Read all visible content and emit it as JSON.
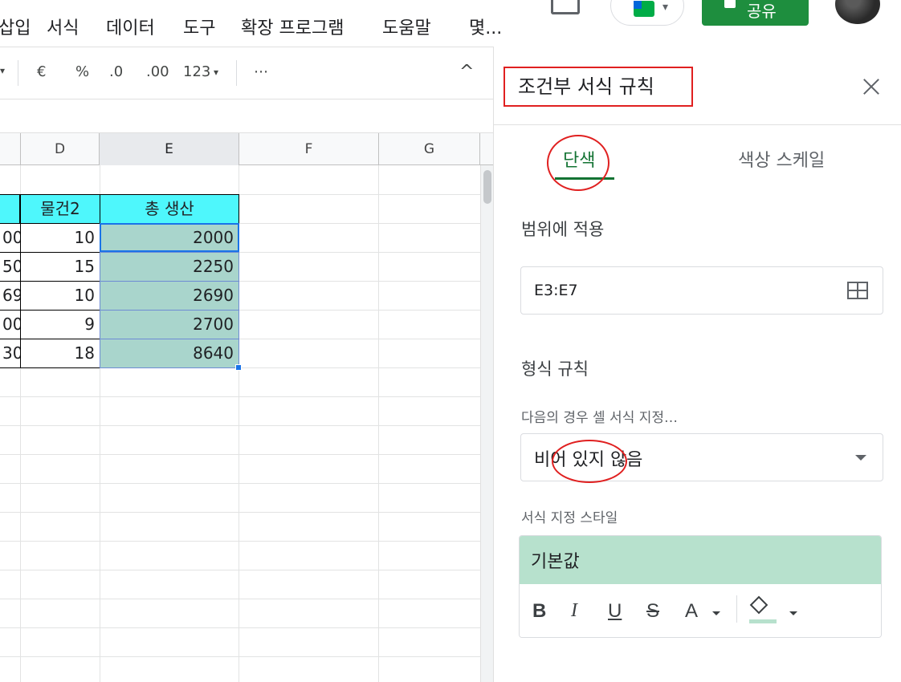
{
  "menu": [
    "삽입",
    "서식",
    "데이터",
    "도구",
    "확장 프로그램",
    "도움말",
    "몇..."
  ],
  "header": {
    "share_label": "공유"
  },
  "toolbar": {
    "currency": "€",
    "percent": "%",
    "dec_decrease": ".0",
    "dec_increase": ".00",
    "number_format": "123",
    "more": "⋯",
    "collapse": "^"
  },
  "columns": [
    "",
    "D",
    "E",
    "F",
    "G"
  ],
  "table": {
    "header": [
      "물건2",
      "총 생산"
    ],
    "rows": [
      {
        "c_partial": "00",
        "d": "10",
        "e": "2000"
      },
      {
        "c_partial": "50",
        "d": "15",
        "e": "2250"
      },
      {
        "c_partial": "69",
        "d": "10",
        "e": "2690"
      },
      {
        "c_partial": "00",
        "d": "9",
        "e": "2700"
      },
      {
        "c_partial": "30",
        "d": "18",
        "e": "8640"
      }
    ]
  },
  "panel": {
    "title": "조건부 서식 규칙",
    "tabs": {
      "single": "단색",
      "scale": "색상 스케일"
    },
    "range_label": "범위에 적용",
    "range_value": "E3:E7",
    "rules_label": "형식 규칙",
    "condition_label": "다음의 경우 셀 서식 지정…",
    "condition_value": "비어 있지 않음",
    "style_label": "서식 지정 스타일",
    "style_preview": "기본값",
    "format_buttons": {
      "bold": "B",
      "italic": "I",
      "underline": "U",
      "strike": "S",
      "text_color": "A"
    }
  },
  "colors": {
    "header_cyan": "#4ef7fc",
    "total_fill": "#a9d5cc",
    "default_style": "#b7e1cd",
    "accent_green": "#137333",
    "annotation_red": "#e02020"
  }
}
